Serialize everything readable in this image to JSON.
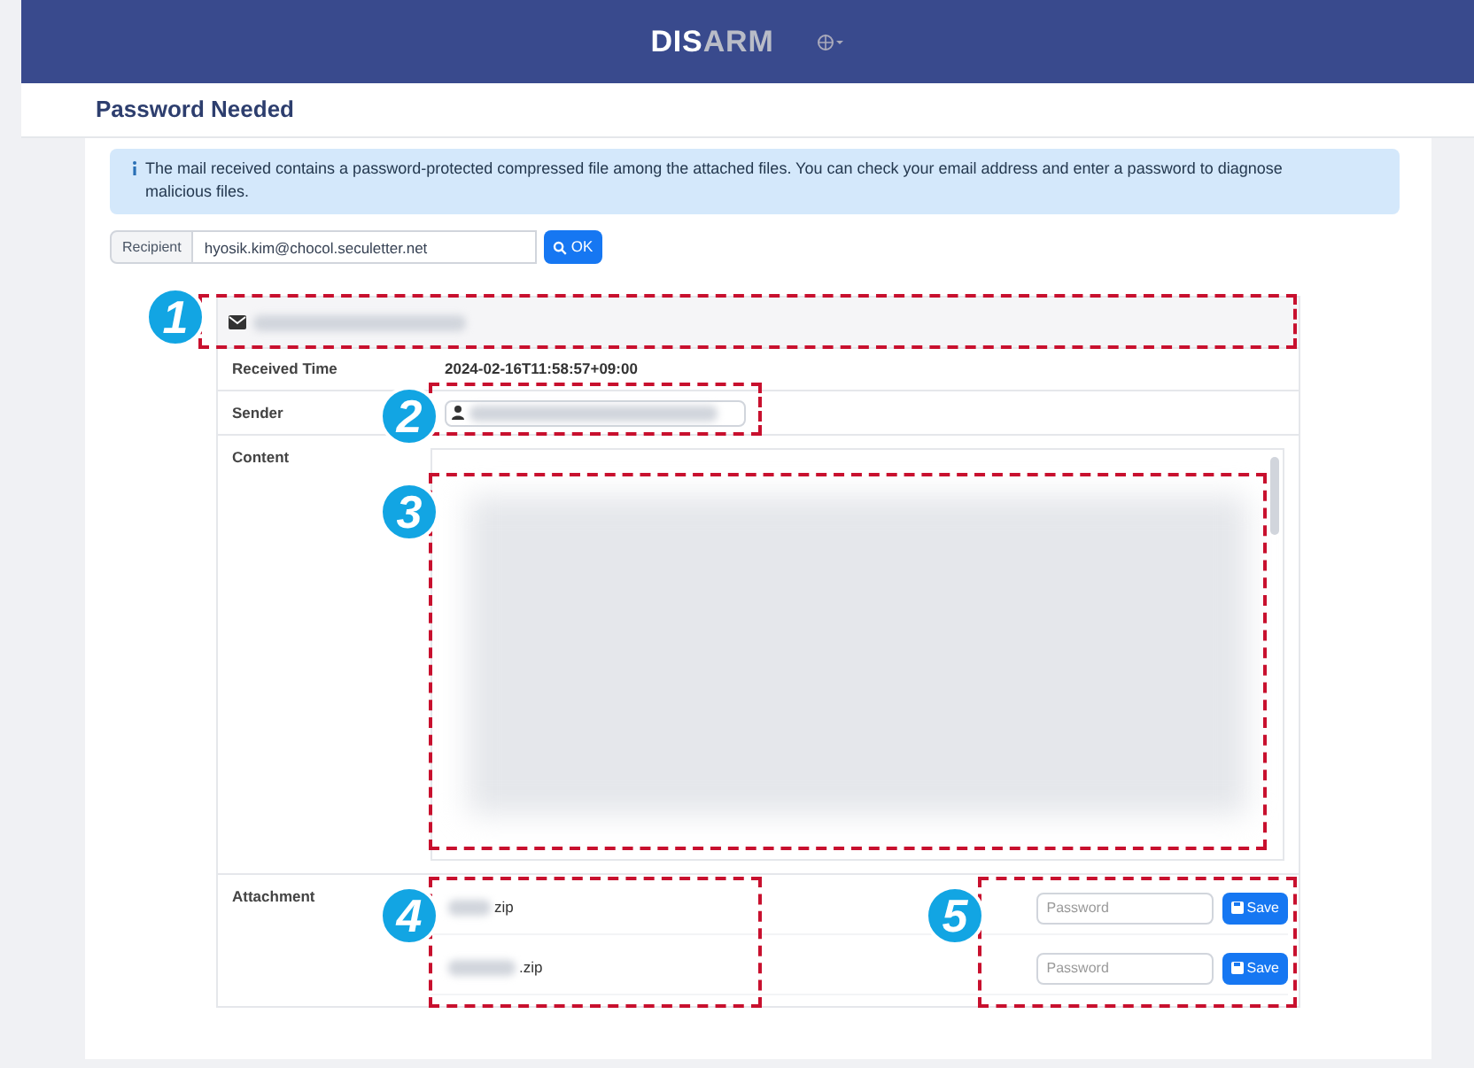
{
  "header": {
    "logo_first": "DIS",
    "logo_second": "ARM"
  },
  "page_title": "Password Needed",
  "alert": "The mail received contains a password-protected compressed file among the attached files. You can check your email address and enter a password to diagnose malicious files.",
  "recipient": {
    "label": "Recipient",
    "value": "hyosik.kim@chocol.seculetter.net",
    "button": "OK"
  },
  "mail": {
    "received_time_label": "Received Time",
    "received_time": "2024-02-16T11:58:57+09:00",
    "sender_label": "Sender",
    "content_label": "Content",
    "attachment_label": "Attachment"
  },
  "attachments": [
    {
      "name": "zip",
      "placeholder": "Password",
      "button": "Save"
    },
    {
      "name": ".zip",
      "placeholder": "Password",
      "button": "Save"
    }
  ],
  "callouts": [
    "1",
    "2",
    "3",
    "4",
    "5"
  ]
}
